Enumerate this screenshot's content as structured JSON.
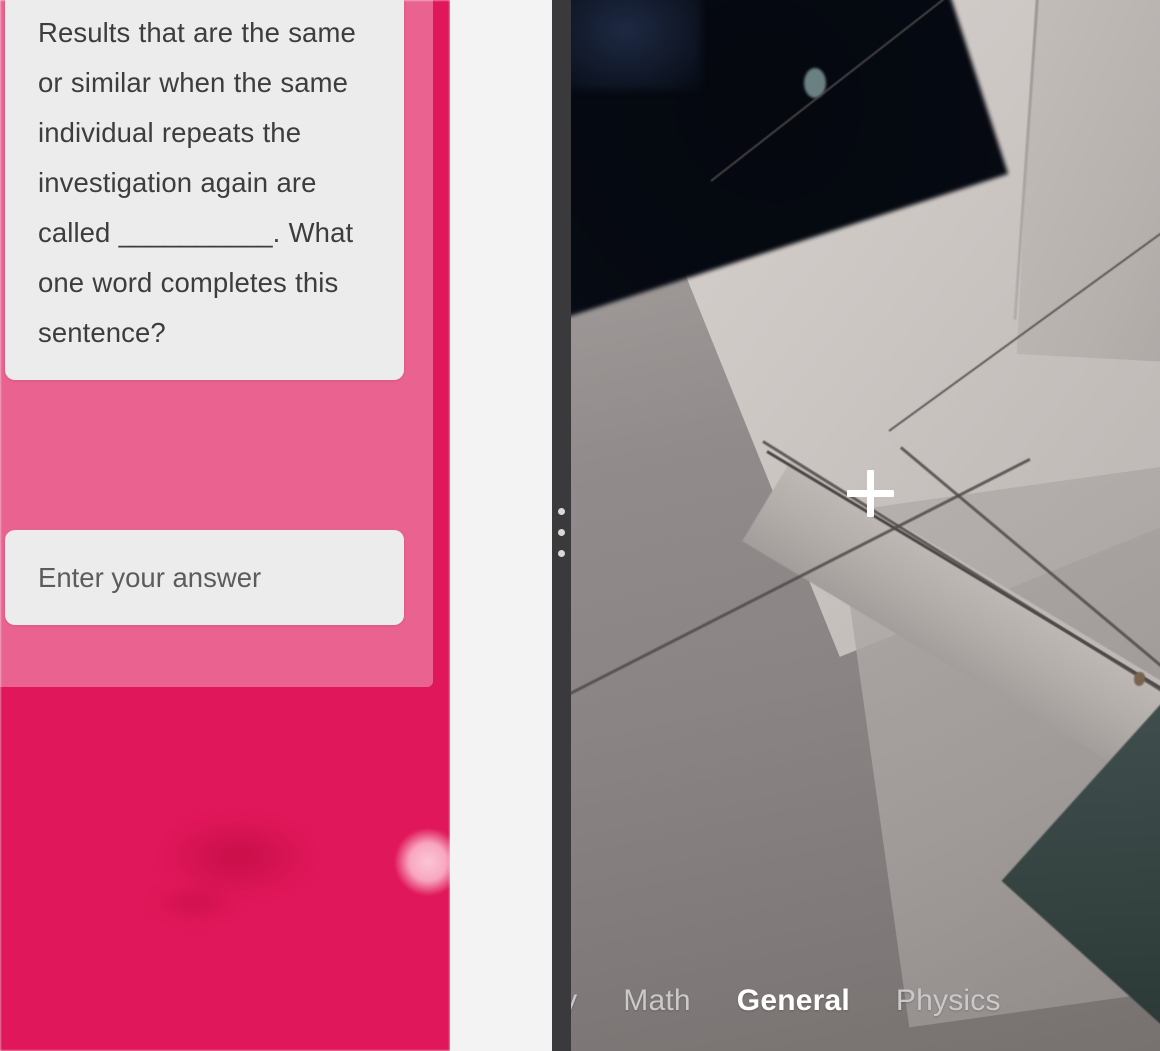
{
  "quiz": {
    "question": "Results that are the same or similar when the same individual repeats the investigation again are called __________. What one word completes this sentence?",
    "answer_value": "",
    "answer_placeholder": "Enter your answer"
  },
  "camera": {
    "crosshair_icon": "plus-crosshair-icon",
    "drag_handle_icon": "three-dots-handle-icon"
  },
  "tabs": {
    "items": [
      {
        "label": "ory",
        "active": false,
        "clipped": true
      },
      {
        "label": "Math",
        "active": false,
        "clipped": false
      },
      {
        "label": "General",
        "active": true,
        "clipped": false
      },
      {
        "label": "Physics",
        "active": false,
        "clipped": false
      }
    ]
  },
  "colors": {
    "card_background": "#ececed",
    "question_text": "#3d3d3d",
    "placeholder_text": "#5c5c5c",
    "accent_pink": "#d91a63",
    "handle_rail": "#3a3a3c",
    "tab_inactive": "#c9c9c9",
    "tab_active": "#ffffff"
  }
}
